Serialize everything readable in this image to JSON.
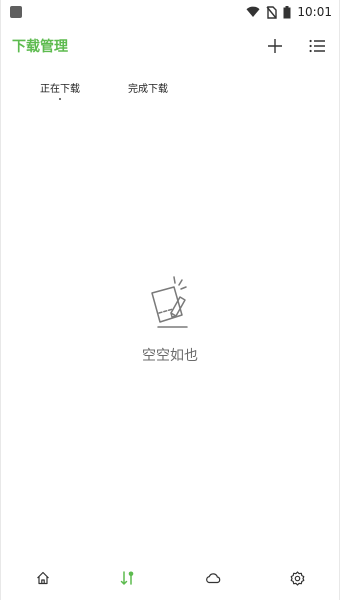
{
  "status_bar": {
    "time": "10:01"
  },
  "app_bar": {
    "title": "下载管理",
    "title_color": "#5dbb4f",
    "actions": [
      {
        "icon": "plus-icon"
      },
      {
        "icon": "list-icon"
      }
    ]
  },
  "tabs": [
    {
      "label": "正在下载",
      "active": true
    },
    {
      "label": "完成下载",
      "active": false
    }
  ],
  "empty_state": {
    "icon": "empty-notepad-icon",
    "text": "空空如也"
  },
  "bottom_nav": {
    "accent_color": "#5dbb4f",
    "items": [
      {
        "icon": "home-icon",
        "active": false
      },
      {
        "icon": "transfer-icon",
        "active": true
      },
      {
        "icon": "cloud-icon",
        "active": false
      },
      {
        "icon": "settings-icon",
        "active": false
      }
    ]
  }
}
